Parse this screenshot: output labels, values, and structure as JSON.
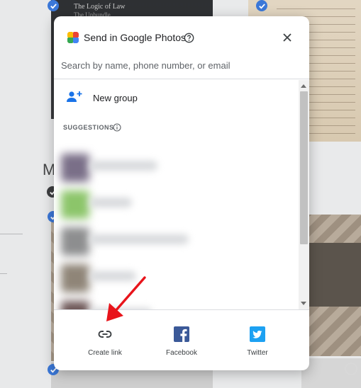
{
  "background": {
    "book_title": "The Logic of Law",
    "book_subtitle": "The Unbundle",
    "section_heading": "M"
  },
  "dialog": {
    "title": "Send in Google Photos",
    "search_placeholder": "Search by name, phone number, or email",
    "new_group_label": "New group",
    "suggestions_label": "SUGGESTIONS",
    "contacts": [
      {
        "avatar_color": "#7a6f88",
        "name_width": 96
      },
      {
        "avatar_color": "#8cc56a",
        "name_width": 60
      },
      {
        "avatar_color": "#8d8e8f",
        "name_width": 140
      },
      {
        "avatar_color": "#8f8578",
        "name_width": 66
      },
      {
        "avatar_color": "#6e5858",
        "name_width": 88
      }
    ],
    "share_options": [
      {
        "label": "Create link",
        "icon": "link-icon"
      },
      {
        "label": "Facebook",
        "icon": "facebook-icon"
      },
      {
        "label": "Twitter",
        "icon": "twitter-icon"
      }
    ]
  },
  "colors": {
    "accent": "#1a73e8",
    "facebook": "#3b5998",
    "twitter": "#1da1f2",
    "annotation_arrow": "#e8141b"
  }
}
